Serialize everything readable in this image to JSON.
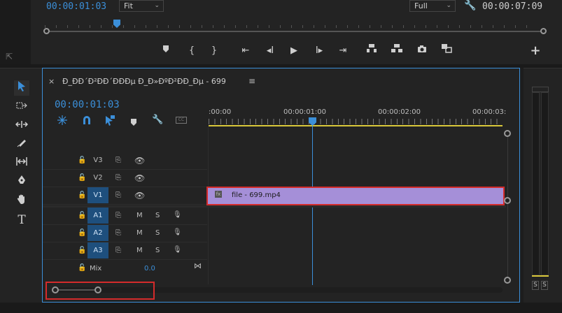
{
  "monitor": {
    "current_timecode": "00:00:01:03",
    "fit_select": "Fit",
    "quality_select": "Full",
    "duration_timecode": "00:00:07:09",
    "transport_icons": [
      "marker-icon",
      "in-point-icon",
      "out-point-icon",
      "go-to-in-icon",
      "step-back-icon",
      "play-icon",
      "step-forward-icon",
      "go-to-out-icon",
      "lift-icon",
      "extract-icon",
      "export-frame-icon",
      "comparison-view-icon",
      "add-button-icon"
    ],
    "add_label": "+"
  },
  "timeline": {
    "sequence_title": "Ð_ÐÐ´Ð²ÐÐ´ÐÐÐµ Ð_Ð»ÐºÐ²ÐÐ_Ðµ - 699",
    "close_label": "×",
    "menu_label": "≡",
    "timecode": "00:00:01:03",
    "ruler": [
      ":00:00",
      "00:00:01:00",
      "00:00:02:00",
      "00:00:03:"
    ],
    "video_tracks": [
      {
        "name": "V3",
        "selected": false
      },
      {
        "name": "V2",
        "selected": false
      },
      {
        "name": "V1",
        "selected": true
      }
    ],
    "audio_tracks": [
      {
        "name": "A1",
        "m": "M",
        "s": "S"
      },
      {
        "name": "A2",
        "m": "M",
        "s": "S"
      },
      {
        "name": "A3",
        "m": "M",
        "s": "S"
      }
    ],
    "mix_label": "Mix",
    "mix_value": "0.0",
    "clip": {
      "label": "file - 699.mp4",
      "fx": "fx"
    }
  },
  "meter": {
    "s_left": "S",
    "s_right": "S"
  },
  "colors": {
    "accent": "#3b8fd9",
    "clip": "#a58fd8",
    "highlight": "#d42b2b",
    "playhead": "#3b8fd9"
  }
}
